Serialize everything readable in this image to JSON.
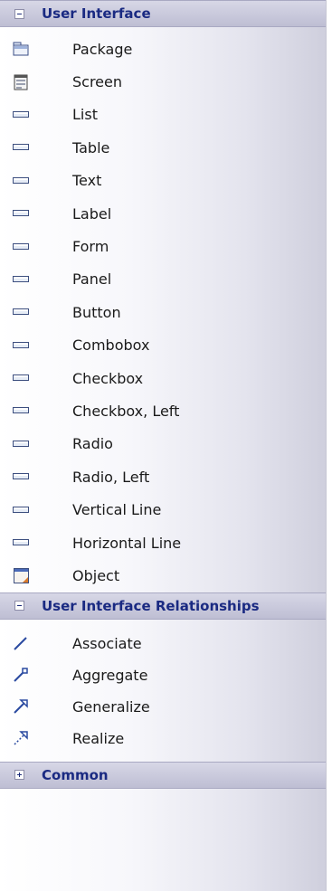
{
  "groups": [
    {
      "title": "User Interface",
      "expanded": true,
      "items": [
        {
          "label": "Package",
          "icon": "package-icon"
        },
        {
          "label": "Screen",
          "icon": "screen-icon"
        },
        {
          "label": "List",
          "icon": "element-icon"
        },
        {
          "label": "Table",
          "icon": "element-icon"
        },
        {
          "label": "Text",
          "icon": "element-icon"
        },
        {
          "label": "Label",
          "icon": "element-icon"
        },
        {
          "label": "Form",
          "icon": "element-icon"
        },
        {
          "label": "Panel",
          "icon": "element-icon"
        },
        {
          "label": "Button",
          "icon": "element-icon"
        },
        {
          "label": "Combobox",
          "icon": "element-icon"
        },
        {
          "label": "Checkbox",
          "icon": "element-icon"
        },
        {
          "label": "Checkbox, Left",
          "icon": "element-icon"
        },
        {
          "label": "Radio",
          "icon": "element-icon"
        },
        {
          "label": "Radio, Left",
          "icon": "element-icon"
        },
        {
          "label": "Vertical Line",
          "icon": "element-icon"
        },
        {
          "label": "Horizontal Line",
          "icon": "element-icon"
        },
        {
          "label": "Object",
          "icon": "object-icon"
        }
      ]
    },
    {
      "title": "User Interface Relationships",
      "expanded": true,
      "items": [
        {
          "label": "Associate",
          "icon": "associate-icon"
        },
        {
          "label": "Aggregate",
          "icon": "aggregate-icon"
        },
        {
          "label": "Generalize",
          "icon": "generalize-icon"
        },
        {
          "label": "Realize",
          "icon": "realize-icon"
        }
      ]
    },
    {
      "title": "Common",
      "expanded": false,
      "items": []
    }
  ],
  "colors": {
    "header_text": "#1a2a82",
    "header_bg": "#c9c9dc",
    "item_text": "#1a1a1a",
    "icon_blue": "#2a4aa0"
  }
}
